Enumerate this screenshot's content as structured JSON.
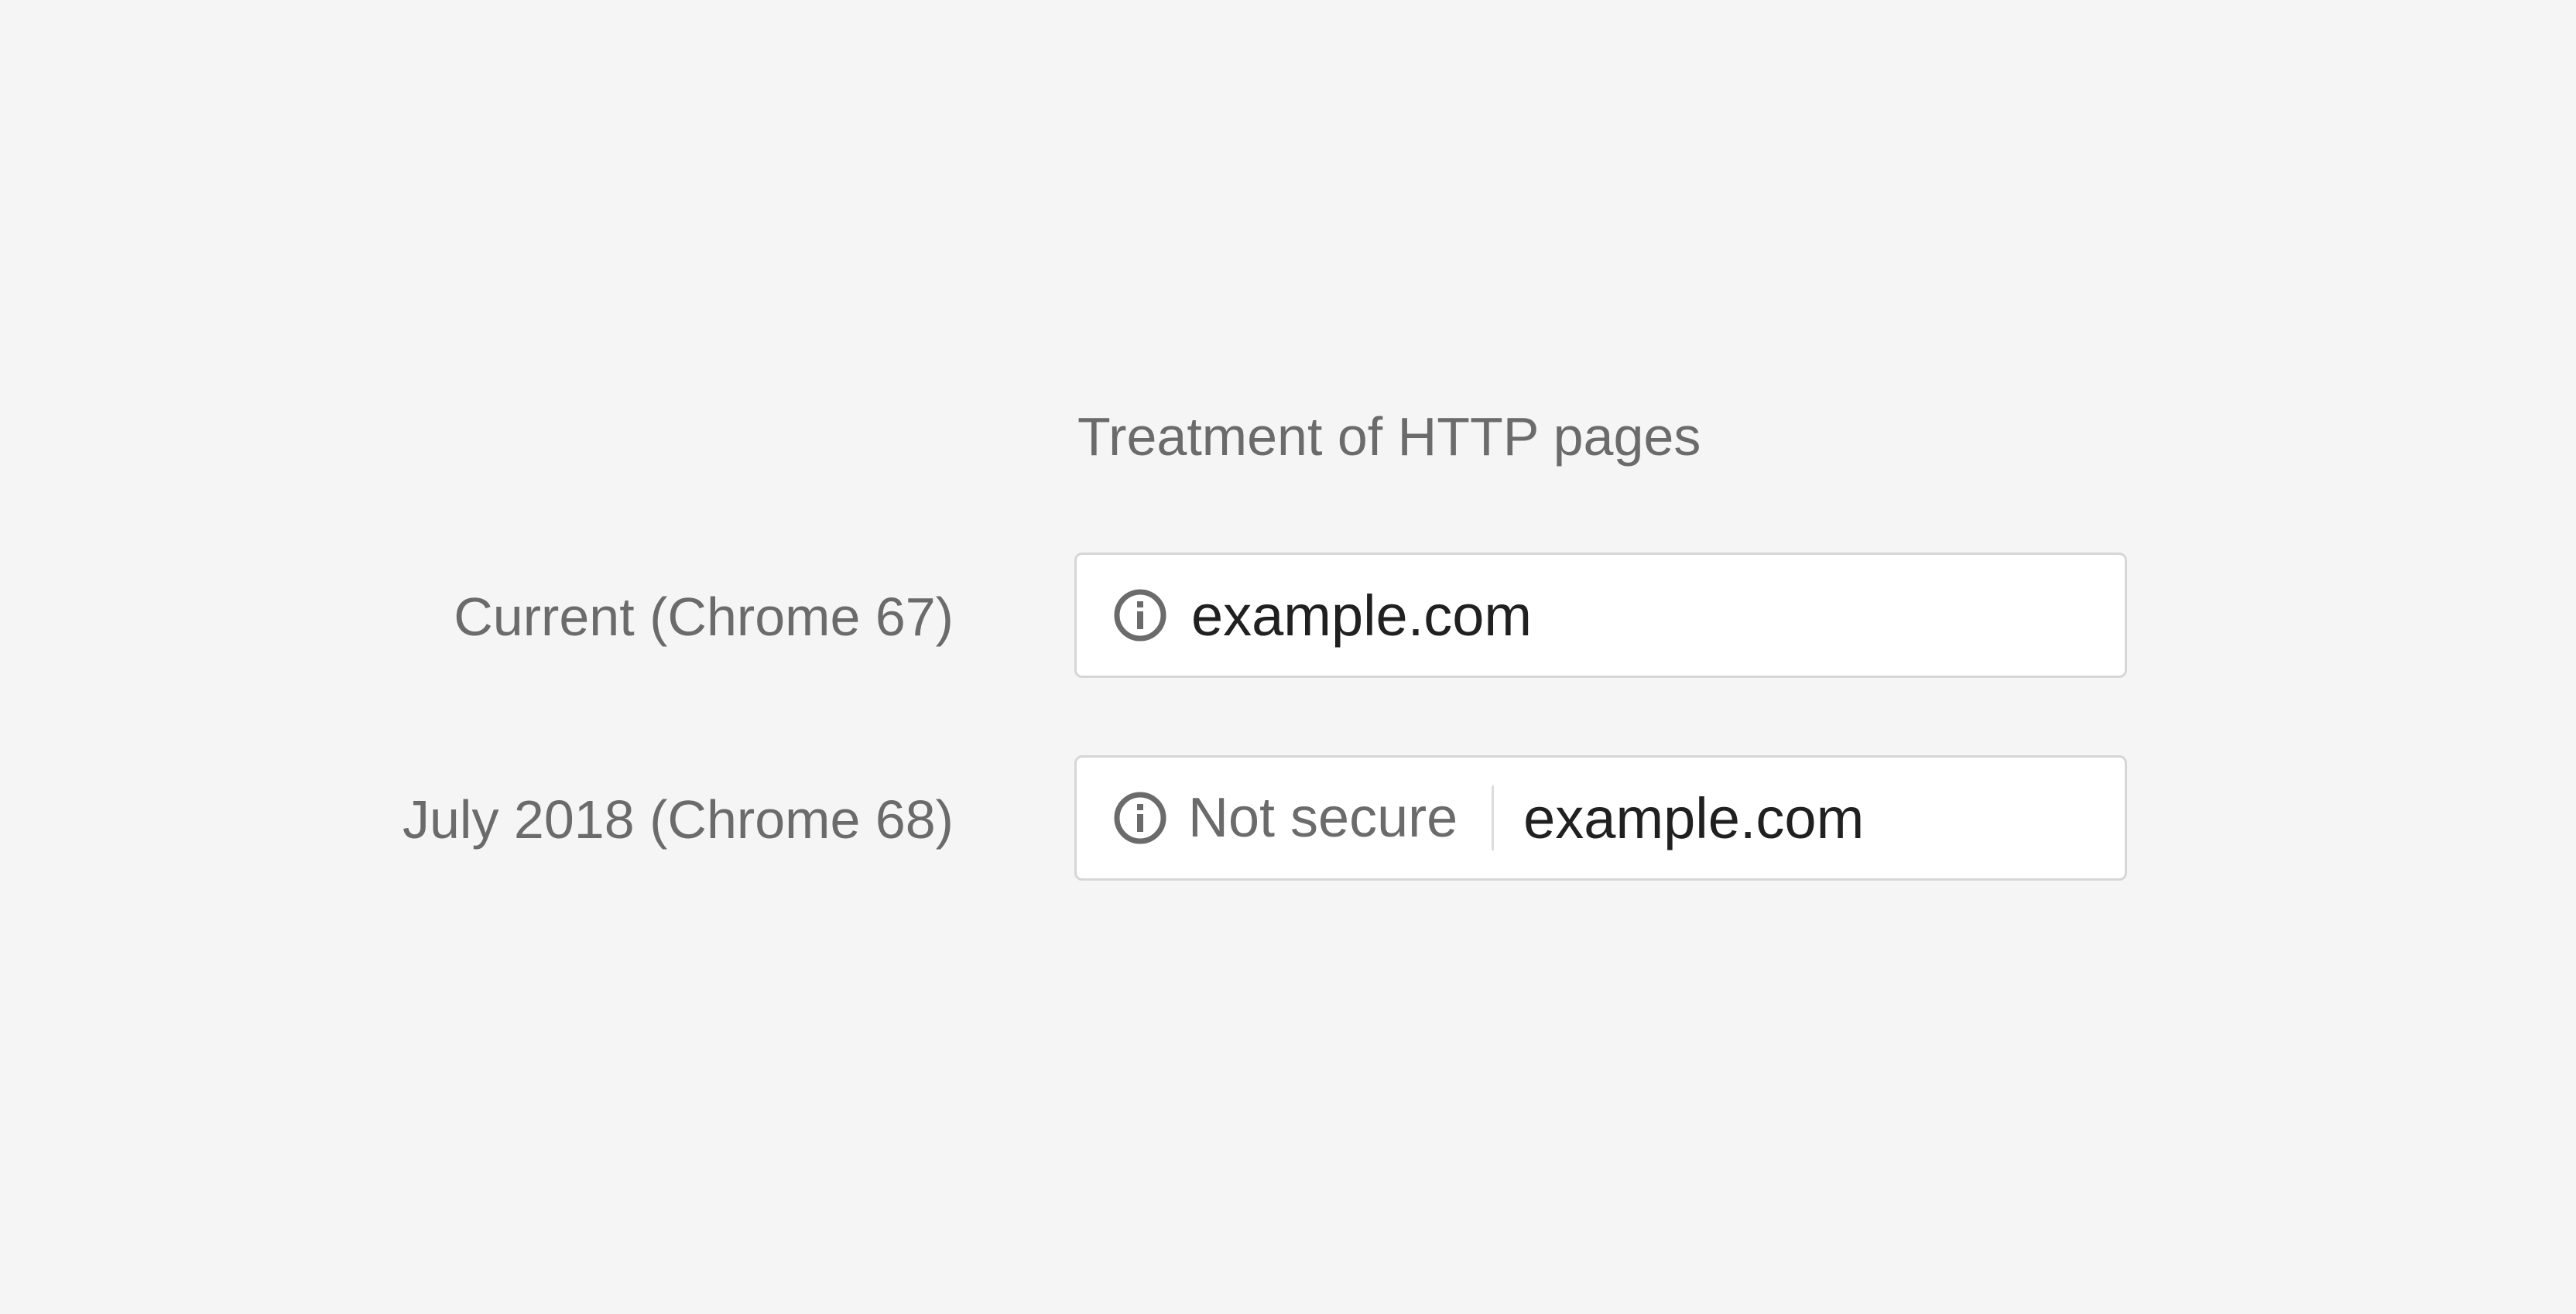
{
  "heading": "Treatment of HTTP pages",
  "rows": [
    {
      "label": "Current (Chrome 67)",
      "icon": "info-icon",
      "security_text": "",
      "url": "example.com"
    },
    {
      "label": "July 2018 (Chrome 68)",
      "icon": "info-icon",
      "security_text": "Not secure",
      "url": "example.com"
    }
  ],
  "colors": {
    "background": "#f5f5f5",
    "label_text": "#6b6b6b",
    "url_text": "#202020",
    "omnibox_border": "#d6d6d6",
    "omnibox_fill": "#ffffff"
  }
}
